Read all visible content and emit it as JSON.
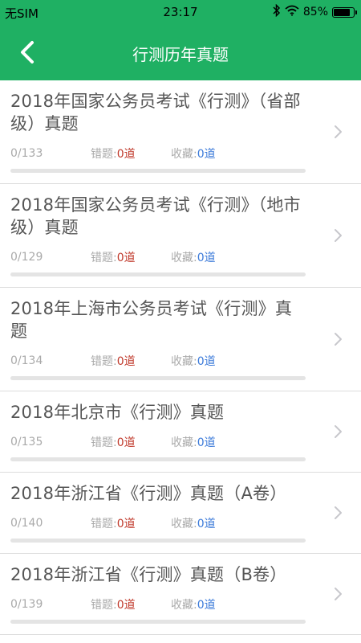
{
  "status": {
    "carrier": "无SIM",
    "time": "23:17",
    "battery": "85%",
    "battery_level": 0.85
  },
  "nav": {
    "title": "行测历年真题"
  },
  "labels": {
    "wrong": "错题:",
    "favorite": "收藏:"
  },
  "items": [
    {
      "title": "2018年国家公务员考试《行测》（省部级）真题",
      "progress": "0/133",
      "wrong": "0道",
      "favorite": "0道",
      "done_fraction": 0
    },
    {
      "title": "2018年国家公务员考试《行测》（地市级）真题",
      "progress": "0/129",
      "wrong": "0道",
      "favorite": "0道",
      "done_fraction": 0
    },
    {
      "title": "2018年上海市公务员考试《行测》真题",
      "progress": "0/134",
      "wrong": "0道",
      "favorite": "0道",
      "done_fraction": 0
    },
    {
      "title": "2018年北京市《行测》真题",
      "progress": "0/135",
      "wrong": "0道",
      "favorite": "0道",
      "done_fraction": 0
    },
    {
      "title": "2018年浙江省《行测》真题（A卷）",
      "progress": "0/140",
      "wrong": "0道",
      "favorite": "0道",
      "done_fraction": 0
    },
    {
      "title": "2018年浙江省《行测》真题（B卷）",
      "progress": "0/139",
      "wrong": "0道",
      "favorite": "0道",
      "done_fraction": 0
    }
  ],
  "colors": {
    "brand": "#1fb063",
    "wrong": "#c0392b",
    "favorite": "#3b7ad9"
  }
}
